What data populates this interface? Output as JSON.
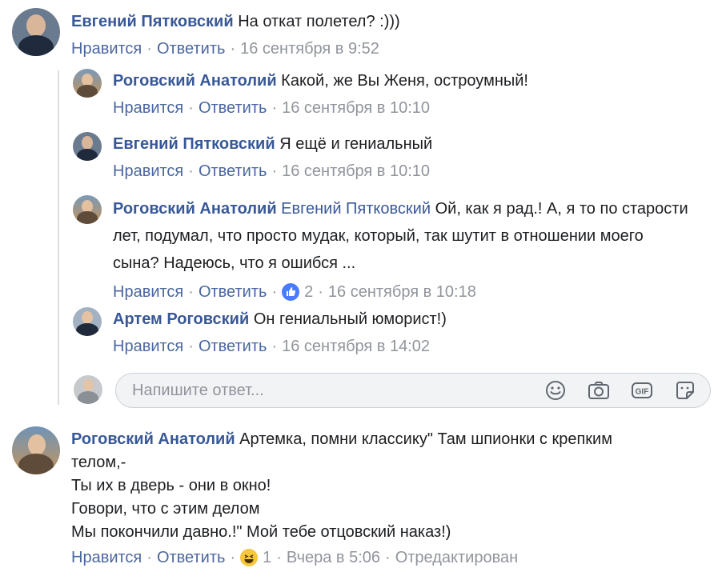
{
  "comments": [
    {
      "author": "Евгений Пятковский",
      "text": "На откат полетел? :)))",
      "like": "Нравится",
      "reply": "Ответить",
      "time": "16 сентября в 9:52"
    }
  ],
  "replies": [
    {
      "author": "Роговский Анатолий",
      "text": "Какой, же Вы Женя, остроумный!",
      "like": "Нравится",
      "reply": "Ответить",
      "time": "16 сентября в 10:10"
    },
    {
      "author": "Евгений Пятковский",
      "text": "Я ещё и гениальный",
      "like": "Нравится",
      "reply": "Ответить",
      "time": "16 сентября в 10:10"
    },
    {
      "author": "Роговский Анатолий",
      "mention": "Евгений Пятковский",
      "text": "Ой, как я рад.! А, я то по старости лет, подумал, что просто мудак, который, так шутит в отношении моего сына? Надеюсь, что я ошибся ...",
      "like": "Нравится",
      "reply": "Ответить",
      "reaction_count": "2",
      "time": "16 сентября в 10:18"
    },
    {
      "author": "Артем Роговский",
      "text": "Он гениальный юморист!)",
      "like": "Нравится",
      "reply": "Ответить",
      "time": "16 сентября в 14:02"
    }
  ],
  "reply_box": {
    "placeholder": "Напишите ответ..."
  },
  "last_comment": {
    "author": "Роговский Анатолий",
    "line1": "Артемка, помни классику\" Там шпионки с крепким",
    "line2": "телом,-",
    "line3": "Ты их в дверь - они в окно!",
    "line4": "Говори, что с этим делом",
    "line5": "Мы покончили давно.!\" Мой тебе отцовский наказ!)",
    "like": "Нравится",
    "reply": "Ответить",
    "reaction_count": "1",
    "time": "Вчера в 5:06",
    "edited": "Отредактирован"
  },
  "icons": {
    "like": "like-icon",
    "haha": "haha-icon",
    "emoji": "emoji-icon",
    "camera": "camera-icon",
    "gif": "gif-icon",
    "sticker": "sticker-icon"
  },
  "colors": {
    "author": "#385898",
    "meta": "#90949c",
    "link": "#4b67a1"
  }
}
